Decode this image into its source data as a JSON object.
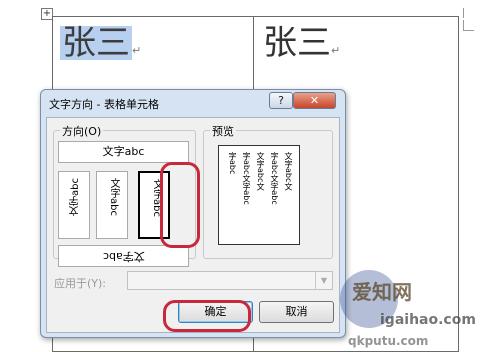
{
  "document": {
    "table_handle_glyph": "+",
    "cell1_text": "张三",
    "cell2_text": "张三",
    "enter_mark": "↵"
  },
  "dialog": {
    "title": "文字方向 - 表格单元格",
    "help_label": "?",
    "close_label": "✕",
    "orientation_group_label": "方向(O)",
    "preview_group_label": "预览",
    "orientation_options": {
      "horizontal": "文字abc",
      "vertical_rotated_left": "文字abc",
      "vertical_stacked": "文字abc",
      "vertical_rotated_right": "文字abc",
      "horizontal_upside_down": "文字abc"
    },
    "selected_option": "vertical_rotated_right",
    "preview_columns": [
      "文字abc文",
      "字abc文字abc",
      "文字abc文",
      "字abc文字abc",
      "字abc"
    ],
    "apply_to_label": "应用于(Y):",
    "apply_to_value": "",
    "ok_label": "确定",
    "cancel_label": "取消"
  },
  "watermark": {
    "line1": "爱知网",
    "line2": "igaihao.com",
    "line3": "qkputu.com"
  },
  "colors": {
    "highlight_oval": "#c8283c",
    "selection": "#b7d0f0",
    "dialog_frame": "#d6e3f3"
  }
}
